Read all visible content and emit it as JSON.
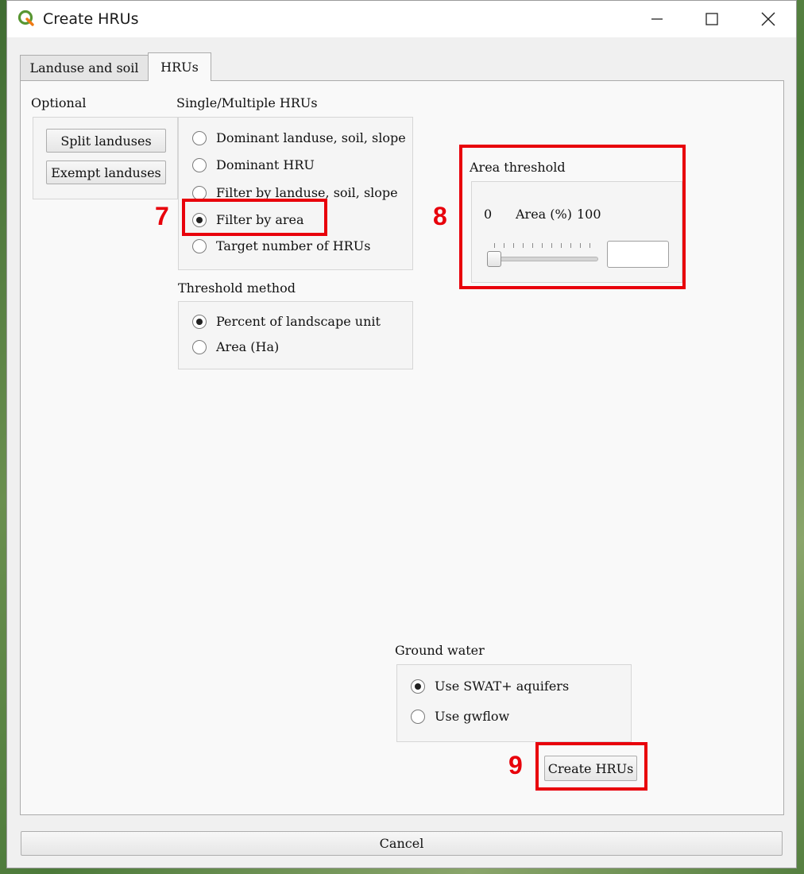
{
  "window": {
    "title": "Create HRUs"
  },
  "tabs": [
    {
      "label": "Landuse and soil"
    },
    {
      "label": "HRUs",
      "active": true
    }
  ],
  "optional": {
    "heading": "Optional",
    "split_label": "Split landuses",
    "exempt_label": "Exempt landuses"
  },
  "hru_mode": {
    "heading": "Single/Multiple HRUs",
    "options": [
      {
        "label": "Dominant landuse, soil, slope",
        "selected": false
      },
      {
        "label": "Dominant HRU",
        "selected": false
      },
      {
        "label": "Filter by landuse, soil, slope",
        "selected": false
      },
      {
        "label": "Filter by area",
        "selected": true
      },
      {
        "label": "Target number of HRUs",
        "selected": false
      }
    ]
  },
  "threshold_method": {
    "heading": "Threshold method",
    "options": [
      {
        "label": "Percent of landscape unit",
        "selected": true
      },
      {
        "label": "Area (Ha)",
        "selected": false
      }
    ]
  },
  "area_threshold": {
    "heading": "Area threshold",
    "min_label": "0",
    "unit_label": "Area (%)",
    "max_label": "100",
    "value": ""
  },
  "ground_water": {
    "heading": "Ground water",
    "options": [
      {
        "label": "Use SWAT+ aquifers",
        "selected": true
      },
      {
        "label": "Use gwflow",
        "selected": false
      }
    ]
  },
  "create_label": "Create HRUs",
  "cancel_label": "Cancel",
  "annotations": {
    "seven": "7",
    "eight": "8",
    "nine": "9"
  },
  "colors": {
    "highlight": "#e8000b",
    "window_bg": "#f0f0f0",
    "panel_bg": "#f9f9f9"
  }
}
